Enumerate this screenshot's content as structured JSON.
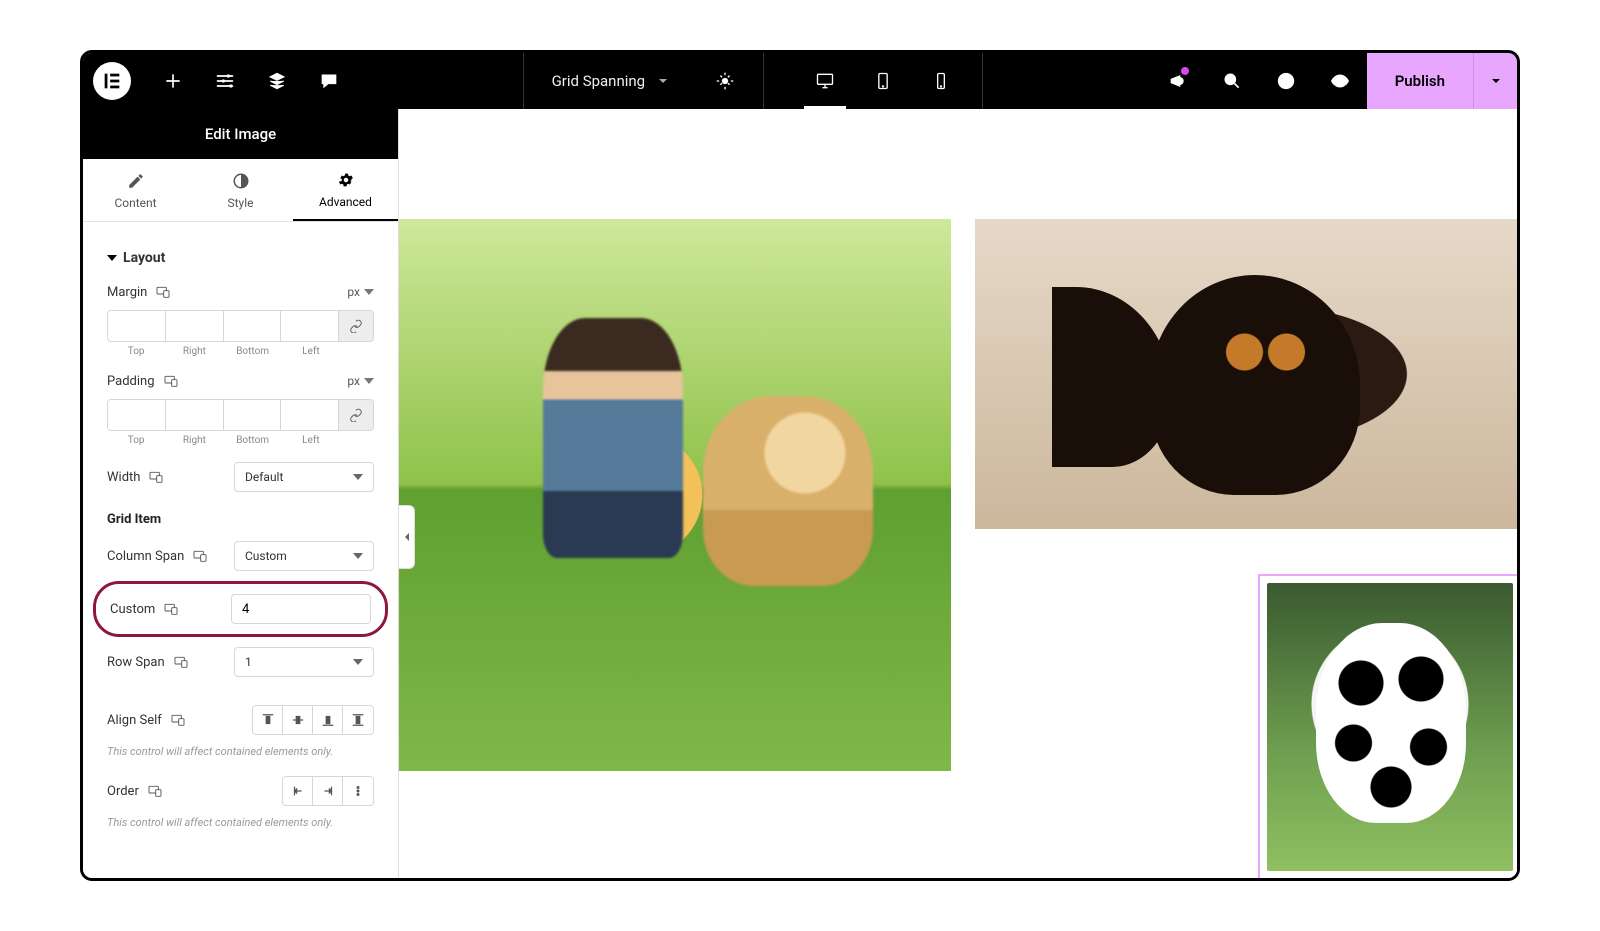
{
  "topbar": {
    "page_title": "Grid Spanning",
    "publish_label": "Publish"
  },
  "panel": {
    "title": "Edit Image",
    "tabs": {
      "content": "Content",
      "style": "Style",
      "advanced": "Advanced"
    },
    "layout": {
      "heading": "Layout",
      "margin_label": "Margin",
      "padding_label": "Padding",
      "unit": "px",
      "sides": {
        "top": "Top",
        "right": "Right",
        "bottom": "Bottom",
        "left": "Left"
      },
      "width_label": "Width",
      "width_value": "Default"
    },
    "grid": {
      "heading": "Grid Item",
      "col_span_label": "Column Span",
      "col_span_value": "Custom",
      "custom_label": "Custom",
      "custom_value": "4",
      "row_span_label": "Row Span",
      "row_span_value": "1",
      "align_self_label": "Align Self",
      "order_label": "Order",
      "help_text": "This control will affect contained elements only."
    }
  }
}
